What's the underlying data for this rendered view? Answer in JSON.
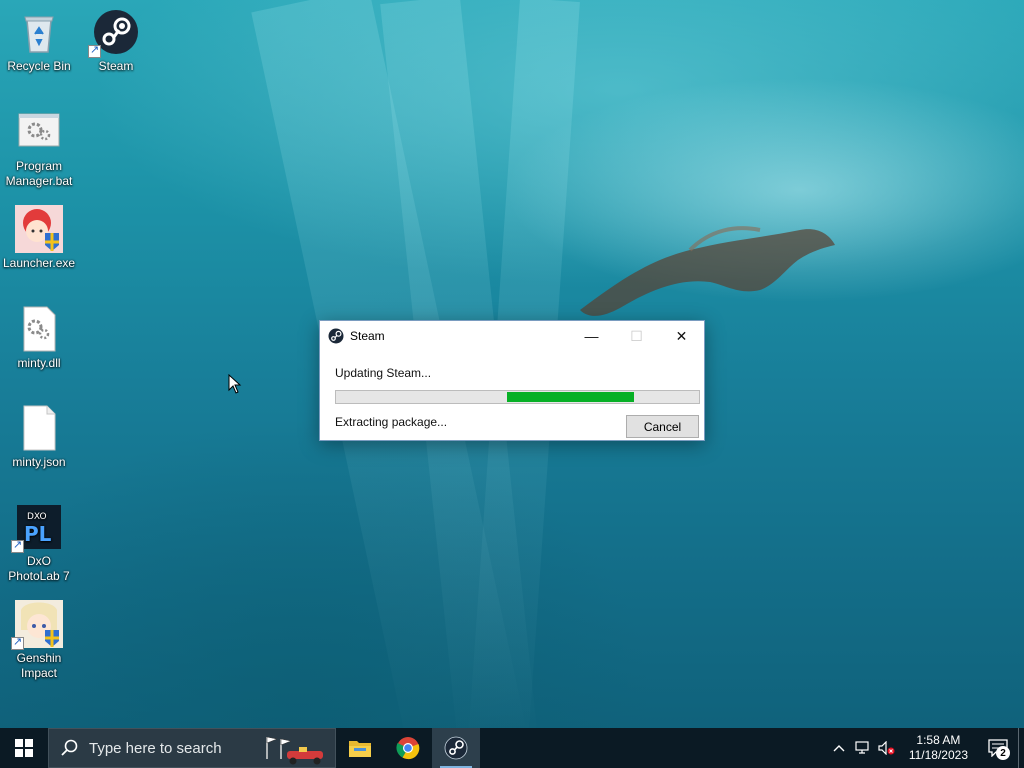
{
  "desktop": {
    "icons": [
      {
        "label": "Recycle Bin",
        "icon": "recycle-bin-icon"
      },
      {
        "label": "Steam",
        "icon": "steam-icon"
      },
      {
        "label": "Program Manager.bat",
        "icon": "batch-file-icon"
      },
      {
        "label": "Launcher.exe",
        "icon": "launcher-icon"
      },
      {
        "label": "minty.dll",
        "icon": "dll-file-icon"
      },
      {
        "label": "minty.json",
        "icon": "json-file-icon"
      },
      {
        "label": "DxO PhotoLab 7",
        "icon": "dxo-photolab-icon"
      },
      {
        "label": "Genshin Impact",
        "icon": "genshin-impact-icon"
      }
    ]
  },
  "dialog": {
    "title": "Steam",
    "minimize_glyph": "—",
    "maximize_glyph": "☐",
    "close_glyph": "✕",
    "status_line": "Updating Steam...",
    "substatus_line": "Extracting package...",
    "cancel_label": "Cancel",
    "progress": {
      "start_fraction": 0.47,
      "end_fraction": 0.82,
      "color": "#06b025"
    }
  },
  "taskbar": {
    "search_placeholder": "Type here to search",
    "apps": [
      {
        "name": "file-explorer",
        "active": false
      },
      {
        "name": "chrome",
        "active": false
      },
      {
        "name": "steam",
        "active": true
      }
    ],
    "tray": {
      "chevron": "^",
      "time": "1:58 AM",
      "date": "11/18/2023",
      "notification_count": "2"
    }
  },
  "colors": {
    "taskbar_bg": "#0b1a24",
    "progress_green": "#06b025",
    "accent_blue": "#7fb4e0"
  }
}
